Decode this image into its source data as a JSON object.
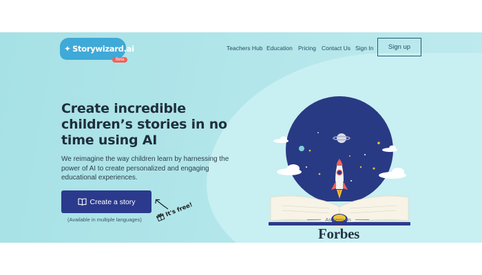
{
  "logo": {
    "name": "Storywizard.ai",
    "badge": "Beta"
  },
  "nav": {
    "items": [
      "Teachers Hub",
      "Education",
      "Pricing",
      "Contact Us",
      "Sign In"
    ],
    "signup": "Sign up"
  },
  "hero": {
    "headline": "Create incredible children’s stories in no time using AI",
    "subtext": "We reimagine the way children learn by harnessing the power of AI to create personalized and engaging educational experiences.",
    "cta": "Create a story",
    "availability": "(Available in multiple languages)",
    "free_note": "It's free!"
  },
  "press": {
    "label": "As seen on",
    "outlet": "Forbes"
  },
  "colors": {
    "hero_bg": "#b2e6ea",
    "cta_bg": "#2b3a8c",
    "night_sky": "#293a84",
    "logo_blue": "#3fa9d7",
    "beta_red": "#f0625b"
  }
}
